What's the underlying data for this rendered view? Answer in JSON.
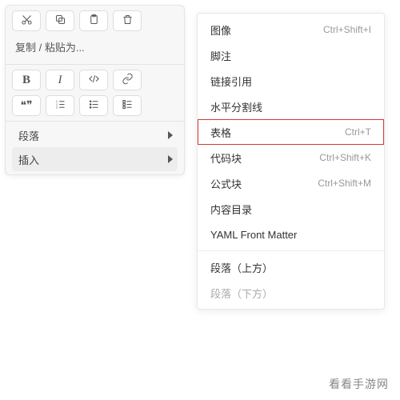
{
  "panel": {
    "paste_label": "复制 / 粘贴为...",
    "icons_row1": [
      "cut",
      "copy",
      "paste",
      "trash"
    ],
    "fmt_bold": "B",
    "fmt_italic": "I",
    "fmt_code": "</>",
    "fmt_link": "link",
    "fmt_quote": "❝❞",
    "fmt_ol": "ol",
    "fmt_ul": "ul",
    "fmt_task": "task",
    "paragraph_label": "段落",
    "insert_label": "插入"
  },
  "submenu": {
    "items": [
      {
        "label": "图像",
        "shortcut": "Ctrl+Shift+I"
      },
      {
        "label": "脚注",
        "shortcut": ""
      },
      {
        "label": "链接引用",
        "shortcut": ""
      },
      {
        "label": "水平分割线",
        "shortcut": ""
      },
      {
        "label": "表格",
        "shortcut": "Ctrl+T",
        "highlight": true
      },
      {
        "label": "代码块",
        "shortcut": "Ctrl+Shift+K"
      },
      {
        "label": "公式块",
        "shortcut": "Ctrl+Shift+M"
      },
      {
        "label": "内容目录",
        "shortcut": ""
      },
      {
        "label": "YAML Front Matter",
        "shortcut": ""
      }
    ],
    "after_sep": [
      {
        "label": "段落（上方）",
        "shortcut": ""
      },
      {
        "label": "段落（下方）",
        "shortcut": "",
        "dim": true
      }
    ]
  },
  "watermark": "看看手游网",
  "colors": {
    "highlight_border": "#d33b36"
  }
}
